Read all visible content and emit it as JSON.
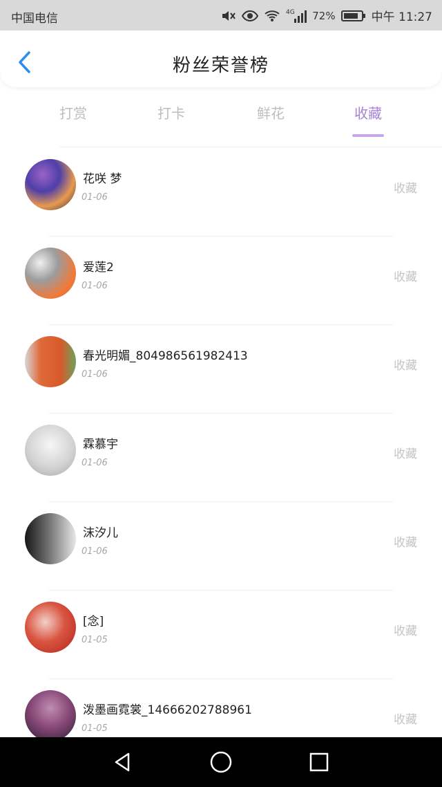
{
  "status_bar": {
    "carrier": "中国电信",
    "network": "4G",
    "battery": "72%",
    "time": "中午 11:27",
    "icons": [
      "mute-icon",
      "eye-icon",
      "wifi-icon",
      "signal-icon",
      "battery-icon"
    ]
  },
  "header": {
    "title": "粉丝荣誉榜",
    "back_icon": "chevron-left-icon",
    "accent": "#2d8cf0"
  },
  "tabs": {
    "items": [
      "打赏",
      "打卡",
      "鲜花",
      "收藏"
    ],
    "active_index": 3,
    "active_color": "#a782d8"
  },
  "list": {
    "rows": [
      {
        "name": "花咲 梦",
        "date": "01-06",
        "action": "收藏"
      },
      {
        "name": "爱莲2",
        "date": "01-06",
        "action": "收藏"
      },
      {
        "name": "春光明媚_804986561982413",
        "date": "01-06",
        "action": "收藏"
      },
      {
        "name": "霖慕宇",
        "date": "01-06",
        "action": "收藏"
      },
      {
        "name": "沫汐儿",
        "date": "01-06",
        "action": "收藏"
      },
      {
        "name": "[念]",
        "date": "01-05",
        "action": "收藏"
      },
      {
        "name": "泼墨画霓裳_14666202788961",
        "date": "01-05",
        "action": "收藏"
      }
    ]
  },
  "nav_bar": {
    "icons": [
      "triangle-back-icon",
      "circle-home-icon",
      "square-recent-icon"
    ]
  }
}
